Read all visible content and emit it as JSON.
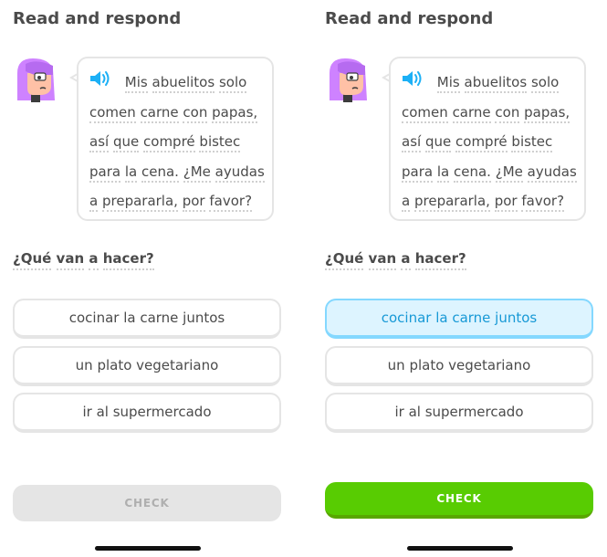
{
  "screens": [
    {
      "heading": "Read and respond",
      "passage_words": [
        "Mis",
        "abuelitos",
        "solo",
        "comen",
        "carne",
        "con",
        "papas,",
        "así",
        "que",
        "compré",
        "bistec",
        "para",
        "la",
        "cena.",
        "¿Me",
        "ayudas",
        "a",
        "prepararla,",
        "por",
        "favor?"
      ],
      "question_words": [
        "¿Qué",
        "van",
        "a",
        "hacer?"
      ],
      "options": [
        "cocinar la carne juntos",
        "un plato vegetariano",
        "ir al supermercado"
      ],
      "selected_option": null,
      "check_label": "CHECK",
      "check_state": "disabled"
    },
    {
      "heading": "Read and respond",
      "passage_words": [
        "Mis",
        "abuelitos",
        "solo",
        "comen",
        "carne",
        "con",
        "papas,",
        "así",
        "que",
        "compré",
        "bistec",
        "para",
        "la",
        "cena.",
        "¿Me",
        "ayudas",
        "a",
        "prepararla,",
        "por",
        "favor?"
      ],
      "question_words": [
        "¿Qué",
        "van",
        "a",
        "hacer?"
      ],
      "options": [
        "cocinar la carne juntos",
        "un plato vegetariano",
        "ir al supermercado"
      ],
      "selected_option": 0,
      "check_label": "CHECK",
      "check_state": "enabled"
    }
  ],
  "icons": {
    "speaker": "speaker-icon",
    "avatar": "character-avatar"
  },
  "colors": {
    "text": "#4b4b4b",
    "border": "#e5e5e5",
    "selected_bg": "#ddf4ff",
    "selected_border": "#84d8ff",
    "selected_text": "#1899d6",
    "check_enabled": "#58cc02",
    "check_disabled": "#e5e5e5",
    "avatar_hair": "#ce82ff",
    "speaker": "#1cb0f6"
  }
}
